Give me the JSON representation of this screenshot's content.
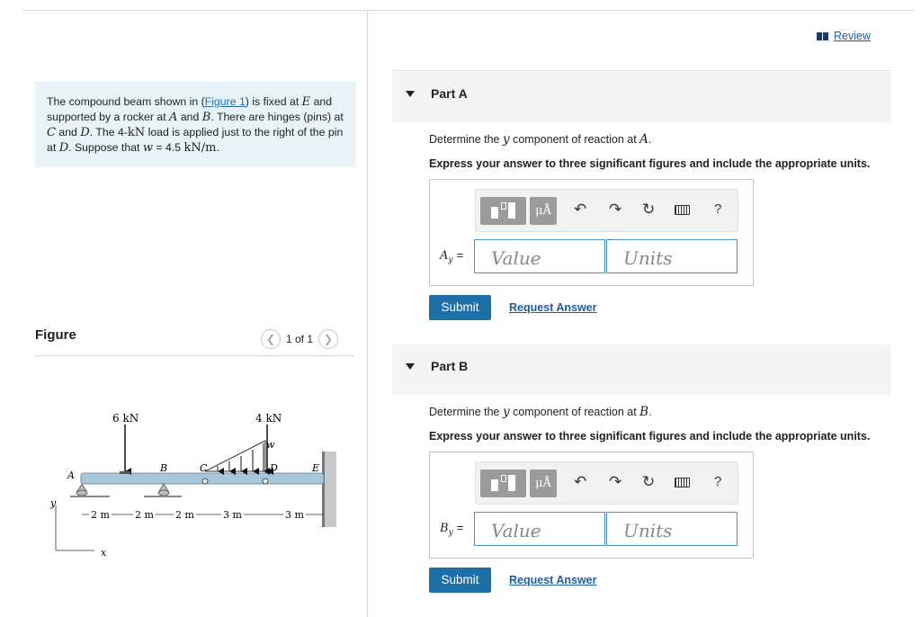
{
  "problem": {
    "t1": "The compound beam shown in (",
    "figure_link": "Figure 1",
    "t2": ") is fixed at ",
    "v_E": "E",
    "t3": " and supported by a rocker at ",
    "v_A": "A",
    "t4": " and ",
    "v_B": "B",
    "t5": ". There are hinges (pins) at ",
    "v_C": "C",
    "t6": " and ",
    "v_D": "D",
    "t7": ". The 4-",
    "unit_kN": "kN",
    "t8": " load is applied just to the right of the pin at ",
    "v_D2": "D",
    "t9": ". Suppose that ",
    "v_w": "w",
    "t10": " = 4.5 ",
    "unit_w": "kN/m",
    "t11": "."
  },
  "figure": {
    "header": "Figure",
    "pager": "1 of 1",
    "labels": {
      "load_6": "6 kN",
      "load_4": "4 kN",
      "w": "w",
      "A": "A",
      "B": "B",
      "C": "C",
      "D": "D",
      "E": "E",
      "y": "y",
      "x": "x",
      "dim1": "2 m",
      "dim2": "2 m",
      "dim3": "2 m",
      "dim4": "3 m",
      "dim5": "3 m"
    }
  },
  "review": "Review",
  "parts": [
    {
      "title": "Part A",
      "prompt_pre": "Determine the ",
      "prompt_var": "y",
      "prompt_mid": " component of reaction at ",
      "prompt_point": "A",
      "prompt_end": ".",
      "instruction": "Express your answer to three significant figures and include the appropriate units.",
      "var_main": "A",
      "var_sub": "y",
      "value_placeholder": "Value",
      "units_placeholder": "Units",
      "submit": "Submit",
      "request": "Request Answer"
    },
    {
      "title": "Part B",
      "prompt_pre": "Determine the ",
      "prompt_var": "y",
      "prompt_mid": " component of reaction at ",
      "prompt_point": "B",
      "prompt_end": ".",
      "instruction": "Express your answer to three significant figures and include the appropriate units.",
      "var_main": "B",
      "var_sub": "y",
      "value_placeholder": "Value",
      "units_placeholder": "Units",
      "submit": "Submit",
      "request": "Request Answer"
    }
  ],
  "toolbar": {
    "mu_label": "μÅ",
    "help": "?",
    "icons": [
      "templates-icon",
      "units-icon",
      "undo-icon",
      "redo-icon",
      "reset-icon",
      "keyboard-icon",
      "help-icon"
    ]
  }
}
